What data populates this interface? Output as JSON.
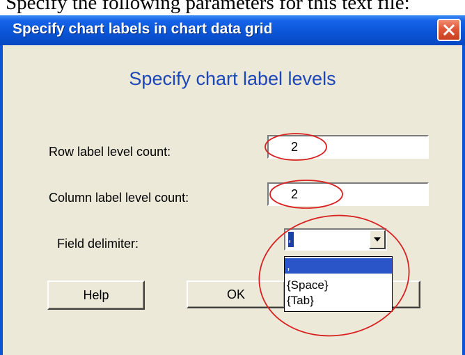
{
  "document": {
    "text_above": "Specify the following parameters for this text file:"
  },
  "dialog": {
    "title": "Specify chart labels in chart data grid",
    "heading": "Specify chart label levels",
    "close_icon": "close-icon",
    "title_color": "#0a55d8",
    "heading_color": "#1c47b8"
  },
  "fields": {
    "row_label": "Row label level count:",
    "row_value": "2",
    "column_label": "Column label level count:",
    "column_value": "2",
    "delimiter_label": "Field delimiter:",
    "delimiter_value": ","
  },
  "dropdown": {
    "arrow_icon": "chevron-down-icon",
    "options": [
      ",",
      "{Space}",
      "{Tab}"
    ],
    "selected_index": 0,
    "highlight_color": "#2a55c8"
  },
  "buttons": {
    "help": "Help",
    "ok": "OK",
    "cancel": ""
  },
  "annotations": {
    "stroke_color": "#d92020"
  }
}
